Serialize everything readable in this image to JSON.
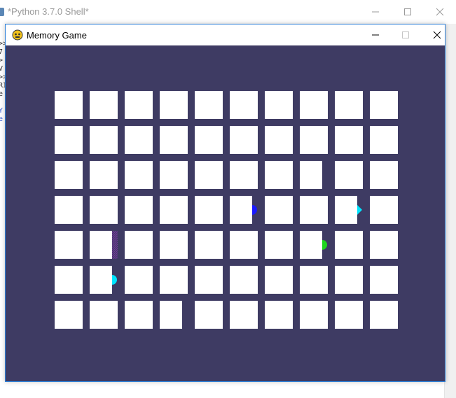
{
  "shell": {
    "title": "*Python 3.7.0 Shell*",
    "side_lines": [
      ">>>",
      "7",
      ">",
      "V",
      ">>",
      "RI",
      "e",
      "",
      "Y",
      "e"
    ],
    "icons": [
      "python-icon",
      "minimize-icon",
      "maximize-icon",
      "close-icon"
    ]
  },
  "game": {
    "title": "Memory Game",
    "background_color": "#3e3b63",
    "tile_color": "#ffffff",
    "grid": {
      "rows": 7,
      "columns": 10
    },
    "revealed_shapes": [
      {
        "row": 3,
        "col": 5,
        "shape": "circle",
        "color": "#1a1aff"
      },
      {
        "row": 3,
        "col": 8,
        "shape": "diamond",
        "color": "#00e5ff"
      },
      {
        "row": 4,
        "col": 1,
        "shape": "lines",
        "color": "#7a3aa0"
      },
      {
        "row": 4,
        "col": 7,
        "shape": "circle",
        "color": "#1ed61e"
      },
      {
        "row": 5,
        "col": 1,
        "shape": "circle",
        "color": "#00e5ff"
      }
    ],
    "icons": [
      "pygame-icon",
      "minimize-icon",
      "maximize-icon",
      "close-icon"
    ]
  }
}
